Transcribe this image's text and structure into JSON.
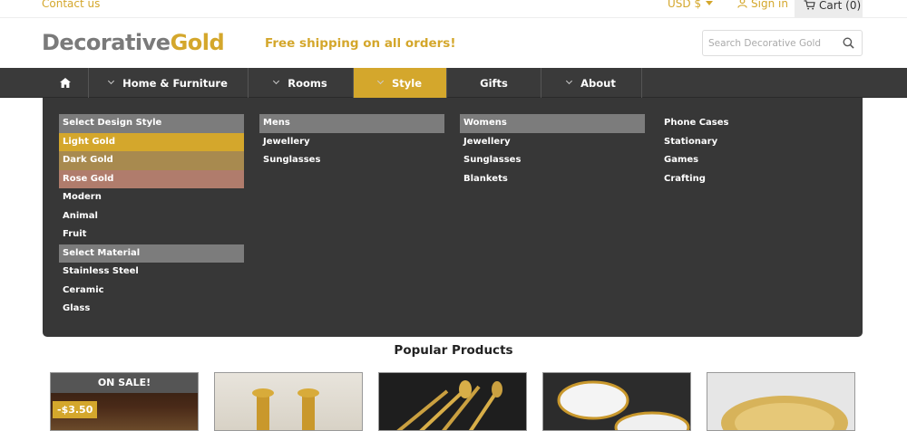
{
  "topbar": {
    "contact": "Contact us",
    "currency": "USD $",
    "signin": "Sign in",
    "cart": "Cart (0)"
  },
  "header": {
    "logo_part1": "Decorative",
    "logo_part2": "Gold",
    "shipping": "Free shipping on all orders!",
    "search_placeholder": "Search Decorative Gold"
  },
  "nav": {
    "items": [
      {
        "label": "Home & Furniture"
      },
      {
        "label": "Rooms"
      },
      {
        "label": "Style"
      },
      {
        "label": "Gifts"
      },
      {
        "label": "About"
      }
    ]
  },
  "menu": {
    "col1": [
      "Select Design Style",
      "Light Gold",
      "Dark Gold",
      "Rose Gold",
      "Modern",
      "Animal",
      "Fruit",
      "Select Material",
      "Stainless Steel",
      "Ceramic",
      "Glass"
    ],
    "col2": [
      "Mens",
      "Jewellery",
      "Sunglasses"
    ],
    "col3": [
      "Womens",
      "Jewellery",
      "Sunglasses",
      "Blankets"
    ],
    "col4": [
      "Phone Cases",
      "Stationary",
      "Games",
      "Crafting"
    ]
  },
  "popular": {
    "title": "Popular Products",
    "sale_banner": "ON SALE!",
    "sale_price": "-$3.50"
  },
  "colors": {
    "accent": "#d4a72c",
    "nav_bg": "#3a3a3a",
    "menu_bg": "#373737",
    "menu_header_bg": "#7c7c7c"
  }
}
